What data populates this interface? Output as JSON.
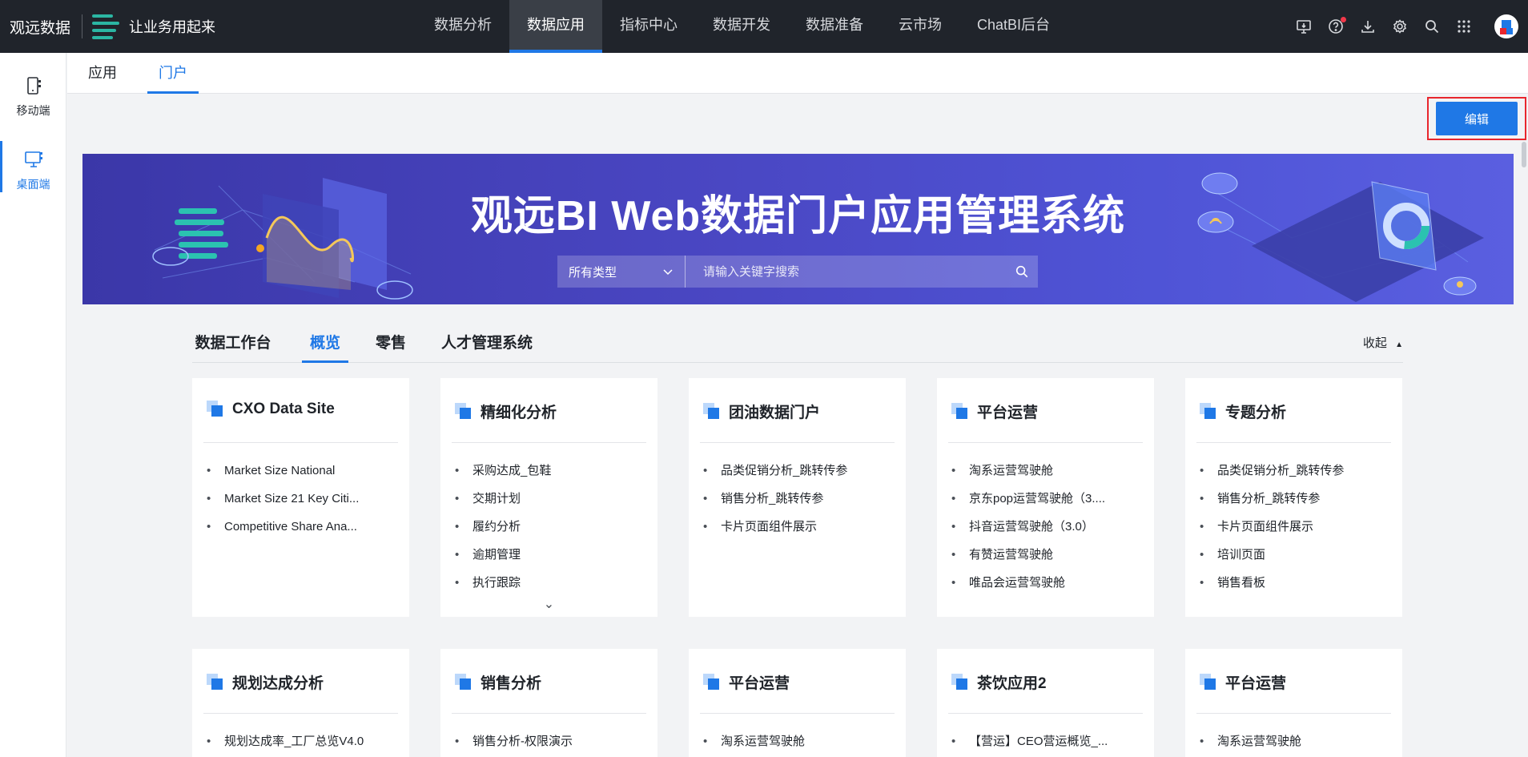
{
  "header": {
    "brand": "观远数据",
    "slogan": "让业务用起来",
    "nav": [
      "数据分析",
      "数据应用",
      "指标中心",
      "数据开发",
      "数据准备",
      "云市场",
      "ChatBI后台"
    ],
    "active_nav": "数据应用",
    "tool_icons": [
      "screen-download-icon",
      "help-icon",
      "download-icon",
      "settings-icon",
      "search-icon",
      "apps-grid-icon",
      "avatar"
    ]
  },
  "sidebar": {
    "items": [
      {
        "label": "移动端",
        "icon": "mobile-icon"
      },
      {
        "label": "桌面端",
        "icon": "desktop-icon"
      }
    ],
    "active": "桌面端"
  },
  "subtabs": {
    "items": [
      "应用",
      "门户"
    ],
    "active": "门户"
  },
  "toolbar": {
    "edit_label": "编辑"
  },
  "banner": {
    "title": "观远BI Web数据门户应用管理系统",
    "search": {
      "type_label": "所有类型",
      "placeholder": "请输入关键字搜索"
    }
  },
  "portal": {
    "tabs": [
      "数据工作台",
      "概览",
      "零售",
      "人才管理系统"
    ],
    "active_tab": "概览",
    "collapse_label": "收起",
    "bullet": "•",
    "expand_symbol": "⌄",
    "cards": [
      {
        "title": "CXO Data Site",
        "items": [
          "Market Size National",
          "Market Size 21 Key Citi...",
          "Competitive Share Ana..."
        ]
      },
      {
        "title": "精细化分析",
        "items": [
          "采购达成_包鞋",
          "交期计划",
          "履约分析",
          "逾期管理",
          "执行跟踪"
        ],
        "has_more": true
      },
      {
        "title": "团油数据门户",
        "items": [
          "品类促销分析_跳转传参",
          "销售分析_跳转传参",
          "卡片页面组件展示"
        ]
      },
      {
        "title": "平台运营",
        "items": [
          "淘系运营驾驶舱",
          "京东pop运营驾驶舱（3....",
          "抖音运营驾驶舱（3.0）",
          "有赞运营驾驶舱",
          "唯品会运营驾驶舱"
        ]
      },
      {
        "title": "专题分析",
        "items": [
          "品类促销分析_跳转传参",
          "销售分析_跳转传参",
          "卡片页面组件展示",
          "培训页面",
          "销售看板"
        ]
      },
      {
        "title": "规划达成分析",
        "items": [
          "规划达成率_工厂总览V4.0"
        ]
      },
      {
        "title": "销售分析",
        "items": [
          "销售分析-权限演示"
        ]
      },
      {
        "title": "平台运营",
        "items": [
          "淘系运营驾驶舱"
        ]
      },
      {
        "title": "茶饮应用2",
        "items": [
          "【营运】CEO营运概览_..."
        ]
      },
      {
        "title": "平台运营",
        "items": [
          "淘系运营驾驶舱"
        ]
      }
    ]
  },
  "colors": {
    "accent": "#1f78e6",
    "topbar": "#20242b",
    "highlight_border": "#e8262d",
    "banner": "#4a47c3"
  }
}
